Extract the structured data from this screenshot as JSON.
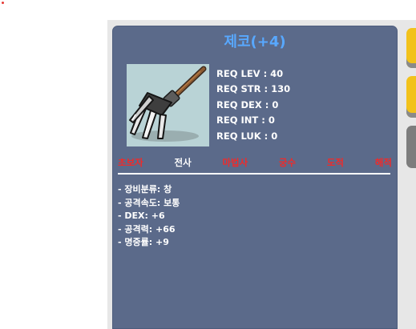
{
  "tooltip": {
    "title": "제코(+4)",
    "item_image_icon": "trident-spear-icon",
    "requirements": [
      "REQ LEV : 40",
      "REQ STR : 130",
      "REQ DEX : 0",
      "REQ INT : 0",
      "REQ LUK : 0"
    ],
    "classes": [
      {
        "label": "초보자",
        "equippable": false
      },
      {
        "label": "전사",
        "equippable": true
      },
      {
        "label": "마법사",
        "equippable": false
      },
      {
        "label": "궁수",
        "equippable": false
      },
      {
        "label": "도적",
        "equippable": false
      },
      {
        "label": "해적",
        "equippable": false
      }
    ],
    "stats": [
      "- 장비분류: 창",
      "- 공격속도: 보통",
      "- DEX: +6",
      "- 공격력: +66",
      "- 명중률: +9"
    ]
  },
  "colors": {
    "panel_bg": "#5b6a8a",
    "title": "#58a8ff",
    "class_unavailable": "#ee2b2b",
    "class_available": "#ffffff",
    "tab_yellow": "#f2c21b",
    "tab_gray": "#7d7d7d"
  }
}
